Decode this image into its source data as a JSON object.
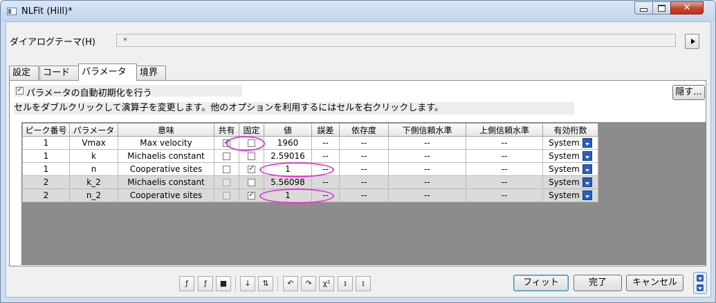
{
  "window": {
    "title": "NLFit (Hill)*"
  },
  "theme": {
    "label": "ダイアログテーマ(H)",
    "value": "*"
  },
  "tabs": [
    {
      "label": "設定",
      "active": false
    },
    {
      "label": "コード",
      "active": false
    },
    {
      "label": "パラメータ",
      "active": true
    },
    {
      "label": "境界",
      "active": false
    }
  ],
  "options": {
    "auto_init_label": "パラメータの自動初期化を行う",
    "auto_init_checked": true,
    "hide_label": "隠す...",
    "hint": "セルをダブルクリックして演算子を変更します。他のオプションを利用するにはセルを右クリックします。"
  },
  "table": {
    "headers": [
      "ピーク番号",
      "パラメータ",
      "意味",
      "共有",
      "固定",
      "値",
      "誤差",
      "依存度",
      "下側信頼水準",
      "上側信頼水準",
      "有効桁数"
    ],
    "rows": [
      {
        "peak": "1",
        "param": "Vmax",
        "meaning": "Max velocity",
        "shared": true,
        "fixed": false,
        "value": "1960",
        "error": "--",
        "dependency": "--",
        "lcl": "--",
        "ucl": "--",
        "sig": "System"
      },
      {
        "peak": "1",
        "param": "k",
        "meaning": "Michaelis constant",
        "shared": false,
        "fixed": false,
        "value": "2.59016",
        "error": "--",
        "dependency": "--",
        "lcl": "--",
        "ucl": "--",
        "sig": "System"
      },
      {
        "peak": "1",
        "param": "n",
        "meaning": "Cooperative sites",
        "shared": false,
        "fixed": true,
        "value": "1",
        "error": "--",
        "dependency": "--",
        "lcl": "--",
        "ucl": "--",
        "sig": "System"
      },
      {
        "peak": "2",
        "param": "k_2",
        "meaning": "Michaelis constant",
        "shared": false,
        "fixed": false,
        "value": "5.56098",
        "error": "--",
        "dependency": "--",
        "lcl": "--",
        "ucl": "--",
        "sig": "System"
      },
      {
        "peak": "2",
        "param": "n_2",
        "meaning": "Cooperative sites",
        "shared": false,
        "fixed": true,
        "value": "1",
        "error": "--",
        "dependency": "--",
        "lcl": "--",
        "ucl": "--",
        "sig": "System"
      }
    ]
  },
  "toolbar_icons": [
    {
      "name": "fx-icon",
      "glyph": "ƒ"
    },
    {
      "name": "function-file-icon",
      "glyph": "ƒ"
    },
    {
      "name": "save-icon",
      "glyph": "■"
    },
    {
      "name": "sort-icon",
      "glyph": "↓"
    },
    {
      "name": "arrange-icon",
      "glyph": "⇅"
    },
    {
      "name": "undo-icon",
      "glyph": "↶"
    },
    {
      "name": "redo-icon",
      "glyph": "↷"
    },
    {
      "name": "chi-square-icon",
      "glyph": "χ²"
    },
    {
      "name": "one-iteration-icon",
      "glyph": "ɪ"
    },
    {
      "name": "fit-until-converged-icon",
      "glyph": "ɪ"
    }
  ],
  "actions": {
    "fit": "フィット",
    "done": "完了",
    "cancel": "キャンセル"
  }
}
